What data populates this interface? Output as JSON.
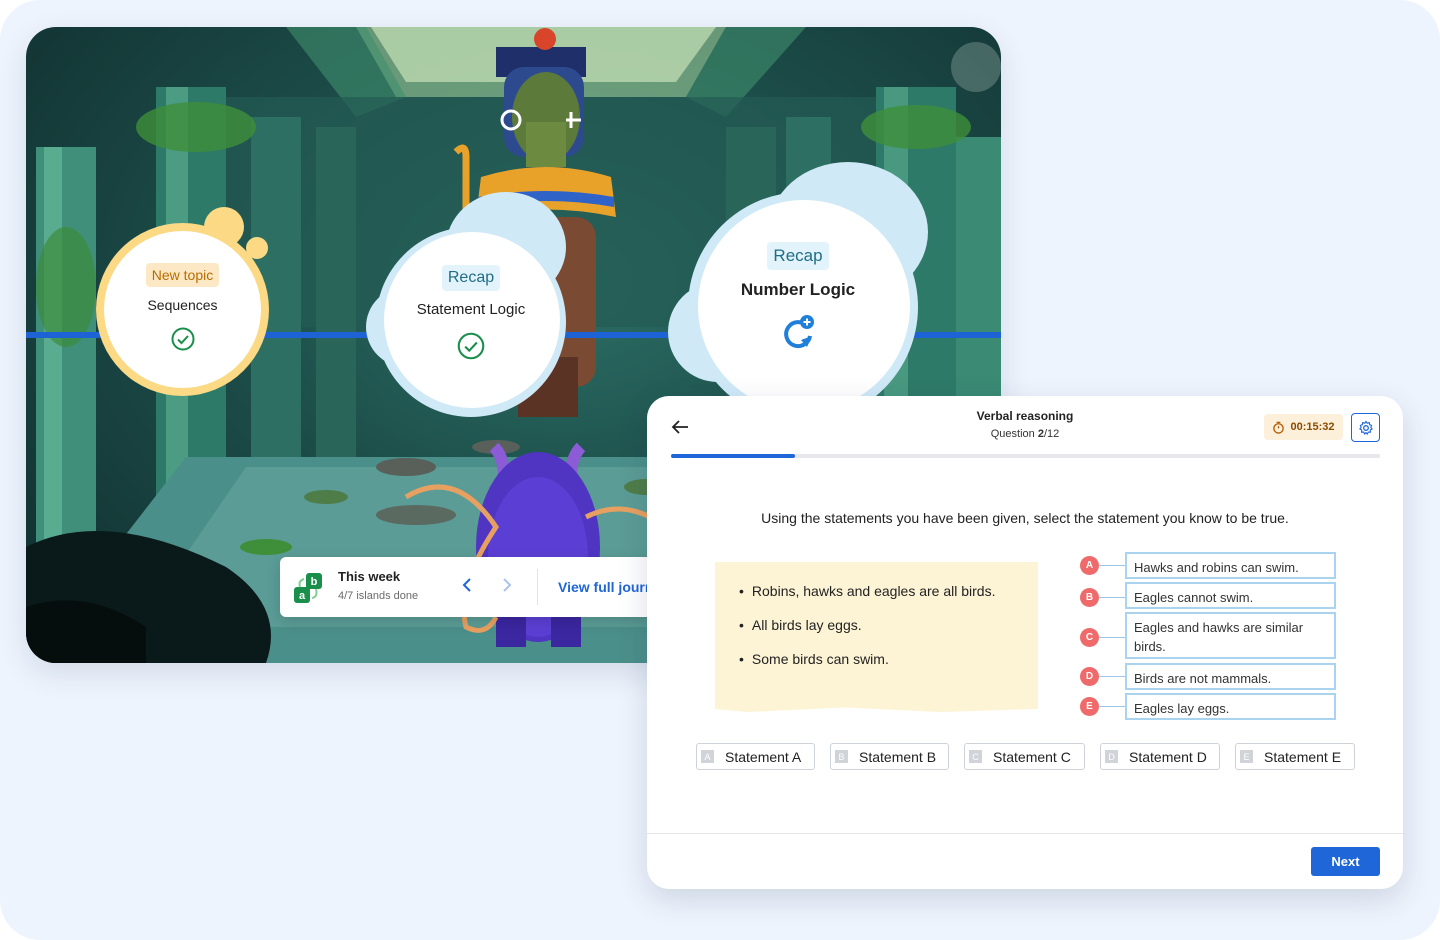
{
  "scene": {
    "nodes": [
      {
        "tag": "New topic",
        "title": "Sequences",
        "status": "check-circle-icon"
      },
      {
        "tag": "Recap",
        "title": "Statement Logic",
        "status": "check-circle-icon"
      },
      {
        "tag": "Recap",
        "title": "Number Logic",
        "status": "refresh-plus-icon"
      }
    ],
    "week": {
      "icon_letters": [
        "a",
        "b"
      ],
      "title": "This week",
      "subtitle": "4/7 islands done",
      "link": "View full journ"
    }
  },
  "quiz": {
    "subject": "Verbal reasoning",
    "question_label": "Question ",
    "question_current": "2",
    "question_total": "/12",
    "timer": "00:15:32",
    "progress": 0.175,
    "prompt": "Using the statements you have been given, select the statement you know to be true.",
    "statements": [
      "Robins, hawks and eagles are all birds.",
      "All birds lay eggs.",
      "Some birds can swim."
    ],
    "options": [
      {
        "letter": "A",
        "text": "Hawks and robins can swim."
      },
      {
        "letter": "B",
        "text": "Eagles cannot swim."
      },
      {
        "letter": "C",
        "text": "Eagles and hawks are similar birds."
      },
      {
        "letter": "D",
        "text": "Birds are not mammals."
      },
      {
        "letter": "E",
        "text": "Eagles lay eggs."
      }
    ],
    "answers": [
      {
        "letter": "A",
        "label": "Statement A"
      },
      {
        "letter": "B",
        "label": "Statement B"
      },
      {
        "letter": "C",
        "label": "Statement C"
      },
      {
        "letter": "D",
        "label": "Statement D"
      },
      {
        "letter": "E",
        "label": "Statement E"
      }
    ],
    "next_label": "Next"
  },
  "colors": {
    "accent": "#1f66d9",
    "option_badge": "#ef6b6b",
    "note_bg": "#fdf4d6",
    "timer_bg": "#fdf0da"
  }
}
